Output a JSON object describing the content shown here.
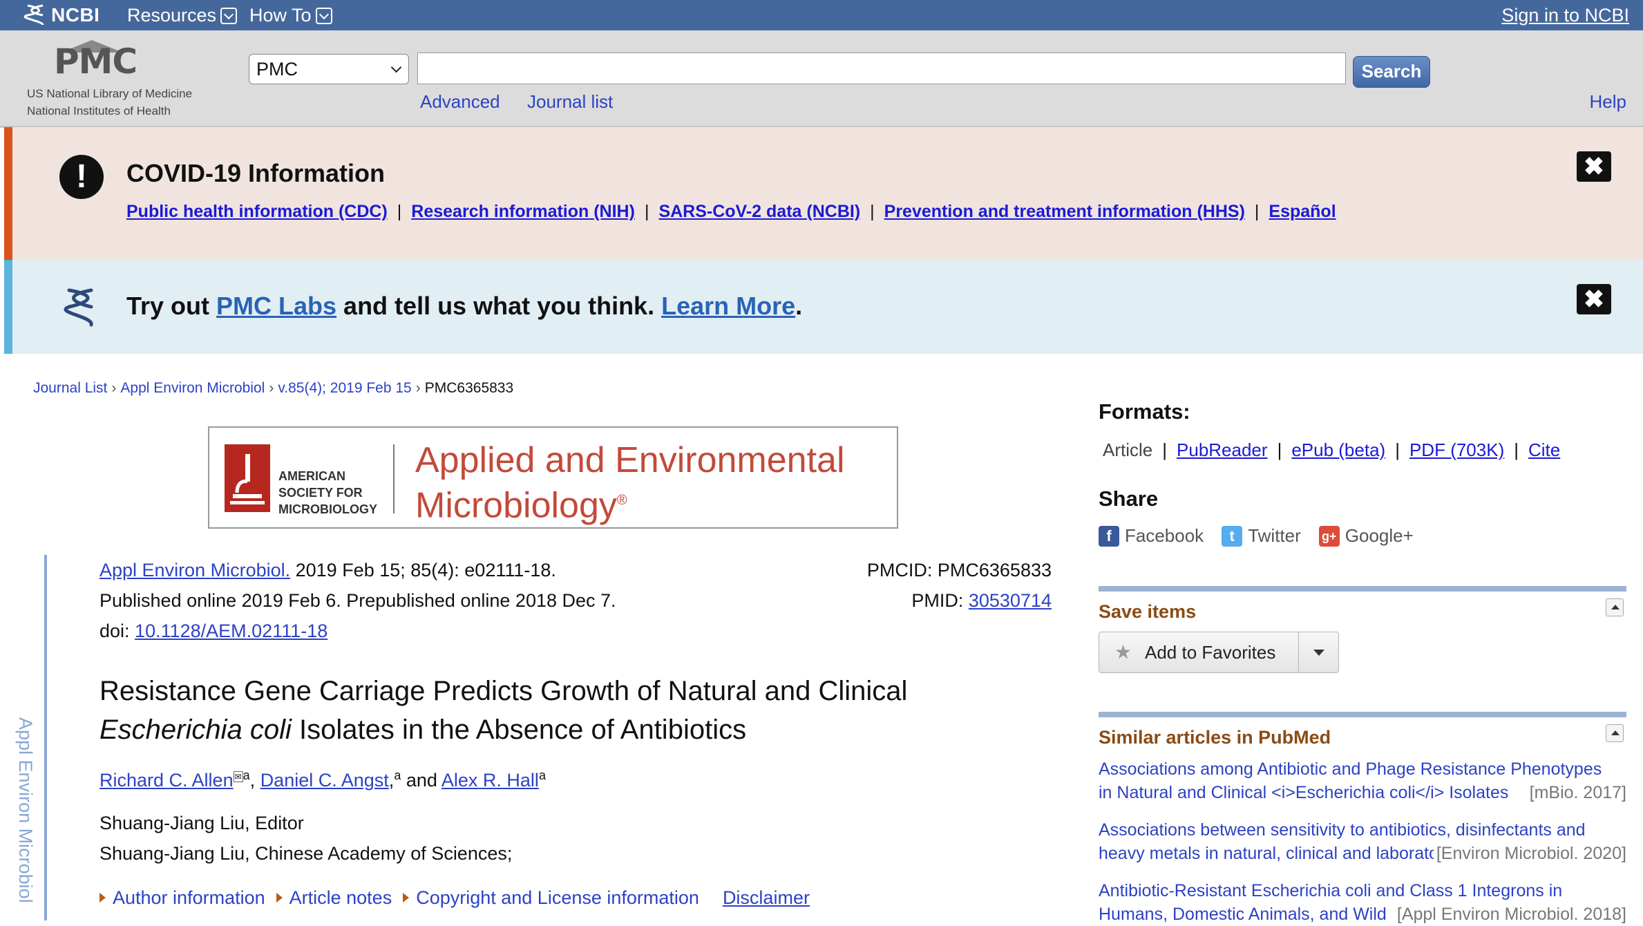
{
  "topbar": {
    "logo_text": "NCBI",
    "menu": [
      {
        "label": "Resources"
      },
      {
        "label": "How To"
      }
    ],
    "signin": "Sign in to NCBI"
  },
  "header": {
    "logo_text": "PMC",
    "org_line1": "US National Library of Medicine",
    "org_line2": "National Institutes of Health",
    "db_selected": "PMC",
    "search_value": "",
    "search_button": "Search",
    "advanced": "Advanced",
    "journal_list": "Journal list",
    "help": "Help"
  },
  "covid": {
    "icon": "exclamation-icon",
    "title": "COVID-19 Information",
    "links": [
      "Public health information (CDC)",
      "Research information (NIH)",
      "SARS-CoV-2 data (NCBI)",
      "Prevention and treatment information (HHS)",
      "Español"
    ],
    "separator": "|",
    "close": "✖"
  },
  "labs": {
    "icon": "dna-helix-icon",
    "text_before": "Try out ",
    "link1": "PMC Labs",
    "text_middle": " and tell us what you think. ",
    "link2": "Learn More",
    "text_after": ".",
    "close": "✖"
  },
  "breadcrumb": {
    "items": [
      "Journal List",
      "Appl Environ Microbiol",
      "v.85(4); 2019 Feb 15"
    ],
    "current": "PMC6365833",
    "sep": "›"
  },
  "journal_banner": {
    "society_line1": "AMERICAN",
    "society_line2": "SOCIETY FOR",
    "society_line3": "MICROBIOLOGY",
    "name_line1": "Applied and Environmental",
    "name_line2": "Microbiology",
    "reg": "®",
    "accent_color": "#c24a3a"
  },
  "side_label": "Appl Environ Microbiol",
  "citation": {
    "journal_link": "Appl Environ Microbiol.",
    "journal_rest": " 2019 Feb 15; 85(4): e02111-18.",
    "published": "Published online 2019 Feb 6. Prepublished online 2018 Dec 7.",
    "doi_label": "doi: ",
    "doi": "10.1128/AEM.02111-18",
    "pmcid": "PMCID: PMC6365833",
    "pmid_label": "PMID: ",
    "pmid": "30530714"
  },
  "article": {
    "title_line1": "Resistance Gene Carriage Predicts Growth of Natural and Clinical",
    "title_italic": "Escherichia coli",
    "title_line2_rest": " Isolates in the Absence of Antibiotics",
    "authors": [
      {
        "name": "Richard C. Allen",
        "sup": "a",
        "corresponding": "✉"
      },
      {
        "name": "Daniel C. Angst",
        "sup": "a"
      },
      {
        "name": "Alex R. Hall",
        "sup": "a"
      }
    ],
    "and": " and ",
    "editor_line1": "Shuang-Jiang Liu, Editor",
    "editor_line2": "Shuang-Jiang Liu, Chinese Academy of Sciences;",
    "info_links": [
      "Author information",
      "Article notes",
      "Copyright and License information"
    ],
    "disclaimer": "Disclaimer"
  },
  "sidebar": {
    "formats_title": "Formats:",
    "formats": [
      "Article",
      "PubReader",
      "ePub (beta)",
      "PDF (703K)",
      "Cite"
    ],
    "share_title": "Share",
    "share": [
      {
        "label": "Facebook",
        "icon": "facebook-icon",
        "color": "#3b5998",
        "glyph": "f"
      },
      {
        "label": "Twitter",
        "icon": "twitter-icon",
        "color": "#55acee",
        "glyph": "t"
      },
      {
        "label": "Google+",
        "icon": "google-plus-icon",
        "color": "#dd4b39",
        "glyph": "g+"
      }
    ],
    "save_title": "Save items",
    "favorites_button": "Add to Favorites",
    "similar_title": "Similar articles in PubMed",
    "similar": [
      {
        "line1": "Associations among Antibiotic and Phage Resistance Phenotypes",
        "line2": "in Natural and Clinical <i>Escherichia coli</i> Isolates",
        "source": "[mBio. 2017]"
      },
      {
        "line1": "Associations between sensitivity to antibiotics, disinfectants and",
        "line2": "heavy metals in natural, clinical and laboratory",
        "source": "[Environ Microbiol. 2020]"
      },
      {
        "line1": "Antibiotic-Resistant Escherichia coli and Class 1 Integrons in",
        "line2": "Humans, Domestic Animals, and Wild",
        "source": "[Appl Environ Microbiol. 2018]"
      }
    ]
  }
}
